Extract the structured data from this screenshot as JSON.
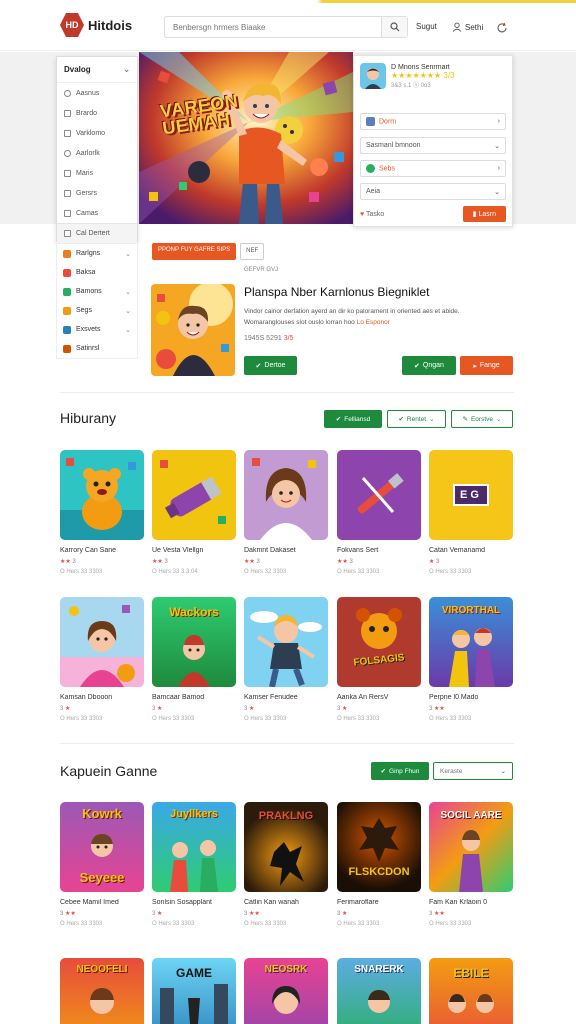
{
  "header": {
    "logo_mark": "HD",
    "logo_text": "Hitdois",
    "search_placeholder": "Benbersgn hrmers Biaake",
    "link_signup": "Sugut",
    "link_login": "Sethi"
  },
  "dropdown": {
    "title": "Dvalog",
    "items": [
      {
        "label": "Aasnus",
        "kind": "radio"
      },
      {
        "label": "Brardo",
        "kind": "check"
      },
      {
        "label": "Varklomo",
        "kind": "check"
      },
      {
        "label": "Aarlorlk",
        "kind": "radio"
      },
      {
        "label": "Maris",
        "kind": "check"
      },
      {
        "label": "Gersrs",
        "kind": "check"
      },
      {
        "label": "Camas",
        "kind": "check"
      },
      {
        "label": "Cal Dertert",
        "kind": "check"
      }
    ]
  },
  "hero": {
    "title_line1": "VAREON",
    "title_line2": "UEMAH"
  },
  "panel": {
    "user": "D Mnons Senrmart",
    "stars": "★★★★★★★ 3/3",
    "sub": "3&3 s.1 ⓢ 0o3",
    "rows": [
      {
        "label": "Dorm",
        "icon_color": "#5b7fb8",
        "arrow": "›"
      },
      {
        "label": "Sasmanl bmnoon",
        "icon_color": "",
        "arrow": "⌄"
      },
      {
        "label": "Sebs",
        "icon_color": "#27ae60",
        "arrow": "›"
      },
      {
        "label": "Aeia",
        "icon_color": "",
        "arrow": "⌄"
      }
    ],
    "foot_label": "Tasko",
    "foot_button": "Lasrn"
  },
  "side_categories": [
    {
      "label": "Rarlgns",
      "color": "#e67e22"
    },
    {
      "label": "Baksa",
      "color": "#e74c3c"
    },
    {
      "label": "Bamons",
      "color": "#27ae60"
    },
    {
      "label": "Segs",
      "color": "#f39c12"
    },
    {
      "label": "Exsvets",
      "color": "#2980b9"
    },
    {
      "label": "Satinrsl",
      "color": "#d35400"
    }
  ],
  "featured": {
    "tag1": "PPONP FUY GAFRE SIPS",
    "tag2": "NEF",
    "meta": "GEFVR GVJ",
    "title": "Planspa Nber Karnlonus Biegniklet",
    "desc_line1": "Vindor cainor derfation ayerd an dir ko palorament in oriented aes et abide.",
    "desc_line2": "Womaranglouses slot ouslo lorran hoo",
    "desc_highlight": "Lo Esponor",
    "date": "1945S 5291",
    "rating": "3/5",
    "btn_left": "Dertoe",
    "btn_mid": "Qngan",
    "btn_right": "Fange"
  },
  "section1": {
    "title": "Hiburany",
    "btn1": "Felliansd",
    "btn2": "Rentet",
    "btn3": "Eorstve",
    "cards": [
      {
        "title": "Karrory Can Sane",
        "rating": "3",
        "meta": "O Hers 33 3303"
      },
      {
        "title": "Ue Vesta Vlellgn",
        "rating": "3",
        "meta": "O Hers 33 3.3.04"
      },
      {
        "title": "Dakmnt Dakaset",
        "rating": "3",
        "meta": "O Hers 32 3303"
      },
      {
        "title": "Fokvans Sert",
        "rating": "3",
        "meta": "O Hers 33 3303"
      },
      {
        "title": "Catan Vemanamd",
        "rating": "3",
        "meta": "O Hers 33 3303"
      },
      {
        "title": "Kamsan Dbooon",
        "rating": "3",
        "meta": "O Hers 33 3303"
      },
      {
        "title": "Bamcaar Bamod",
        "rating": "3",
        "meta": "O Hers 33 3303"
      },
      {
        "title": "Kamser Fenudee",
        "rating": "3",
        "meta": "O Hers 33 3303"
      },
      {
        "title": "Aanka An RersV",
        "rating": "3",
        "meta": "O Hers 33 3303"
      },
      {
        "title": "Perpne l0 Mado",
        "rating": "3",
        "meta": "O Hers 33 3303"
      }
    ]
  },
  "section2": {
    "title": "Kapuein Ganne",
    "btn1": "Ginp Fhun",
    "btn2": "Keraste",
    "cards": [
      {
        "title": "Cebee Mamil Imed",
        "rating": "3",
        "meta": "O Hers 33 3303"
      },
      {
        "title": "Sonlsin Sosapplant",
        "rating": "3",
        "meta": "O Hers 33 3303"
      },
      {
        "title": "Catlin Kan wanah",
        "rating": "3",
        "meta": "O Hers 33 3303"
      },
      {
        "title": "Ferimaroflare",
        "rating": "3",
        "meta": "O Hers 33 3303"
      },
      {
        "title": "Fam Kan Krlaoin 0",
        "rating": "3",
        "meta": "O Hers 33 3303"
      }
    ]
  },
  "thumb_texts": {
    "s1_4": "EG",
    "s1_6": "Wackors",
    "s1_9": "FOLSAGIS",
    "s1_10": "VIRORTHAL",
    "s2_1_a": "Kowrk",
    "s2_1_b": "Seyeee",
    "s2_2": "Juyllkers",
    "s2_3": "PRAKLNG",
    "s2_4": "FLSKCDON",
    "s2_5": "SOCIL AARE",
    "s3_1": "NEOOFELI",
    "s3_2": "GAME",
    "s3_3": "NEOSRK",
    "s3_4": "SNARERK",
    "s3_5": "EBILE"
  }
}
